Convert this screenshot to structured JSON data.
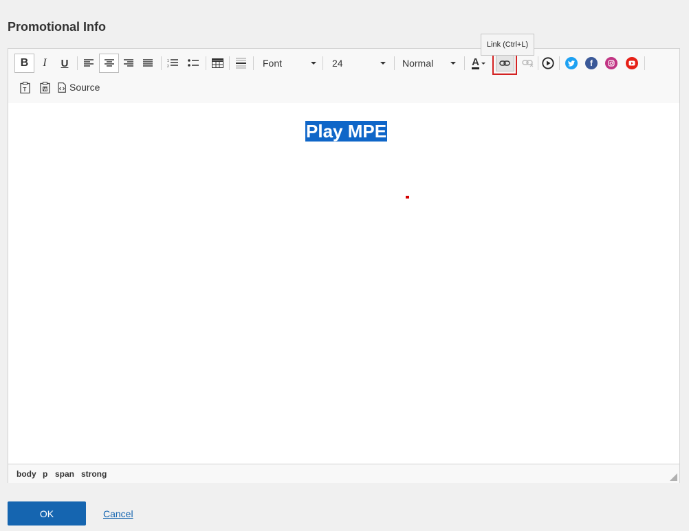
{
  "page": {
    "title": "Promotional Info"
  },
  "toolbar": {
    "bold_label": "B",
    "italic_label": "I",
    "underline_label": "U",
    "font_combo": {
      "value": "Font"
    },
    "size_combo": {
      "value": "24"
    },
    "format_combo": {
      "value": "Normal"
    },
    "textcolor_label": "A",
    "source_label": "Source",
    "tooltip": "Link (Ctrl+L)",
    "highlight_color": "#d32222"
  },
  "content": {
    "selected_text": "Play MPE",
    "selection_color": "#0f66c8"
  },
  "statusbar": {
    "path": [
      "body",
      "p",
      "span",
      "strong"
    ]
  },
  "actions": {
    "ok_label": "OK",
    "cancel_label": "Cancel",
    "ok_color": "#1565b0"
  }
}
